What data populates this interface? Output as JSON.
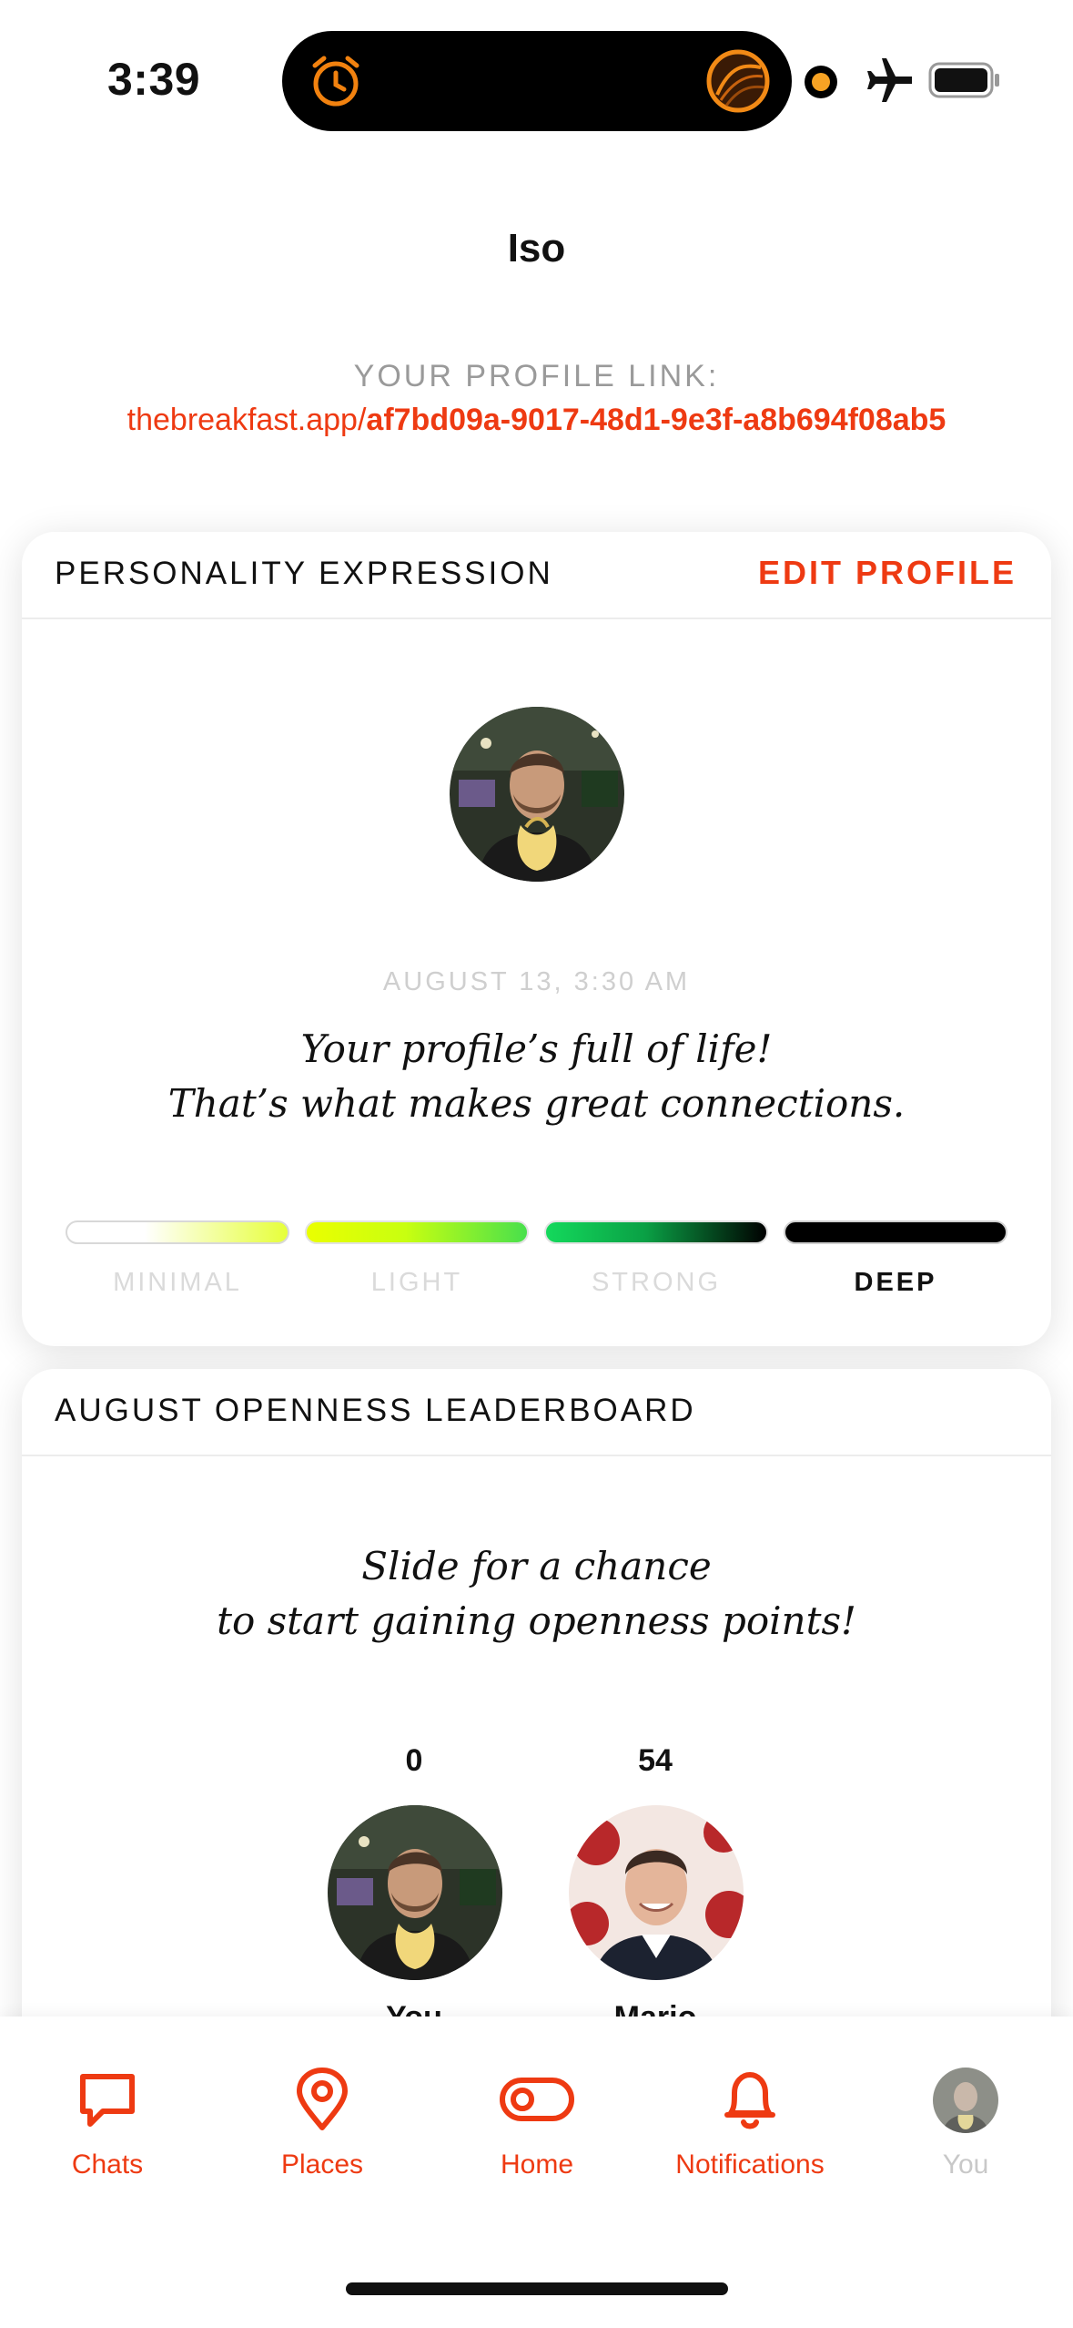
{
  "status_bar": {
    "time": "3:39",
    "icons": [
      "alarm-icon",
      "activity-ring-icon",
      "recording-dot-icon",
      "airplane-icon",
      "battery-icon"
    ]
  },
  "header": {
    "title": "Iso",
    "profile_link_label": "YOUR PROFILE LINK:",
    "profile_link_domain": "thebreakfast.app/",
    "profile_link_id": "af7bd09a-9017-48d1-9e3f-a8b694f08ab5"
  },
  "personality_card": {
    "title": "PERSONALITY EXPRESSION",
    "action": "EDIT PROFILE",
    "date": "AUGUST 13, 3:30 AM",
    "message_line1": "Your profile’s full of life!",
    "message_line2": "That’s what makes great connections.",
    "scale": [
      {
        "label": "MINIMAL"
      },
      {
        "label": "LIGHT"
      },
      {
        "label": "STRONG"
      },
      {
        "label": "DEEP"
      }
    ],
    "selected_level": "DEEP"
  },
  "leaderboard_card": {
    "title": "AUGUST OPENNESS LEADERBOARD",
    "message_line1": "Slide for a chance",
    "message_line2": "to start gaining openness points!",
    "entries": [
      {
        "score": "0",
        "name": "You"
      },
      {
        "score": "54",
        "name": "Mario"
      }
    ]
  },
  "tab_bar": {
    "tabs": [
      {
        "label": "Chats",
        "icon": "chat-bubble-icon"
      },
      {
        "label": "Places",
        "icon": "map-pin-icon"
      },
      {
        "label": "Home",
        "icon": "toggle-icon"
      },
      {
        "label": "Notifications",
        "icon": "bell-icon"
      },
      {
        "label": "You",
        "icon": "avatar-icon"
      }
    ]
  },
  "colors": {
    "accent": "#ee3a12",
    "muted": "#9a9a9a",
    "text": "#111111"
  }
}
